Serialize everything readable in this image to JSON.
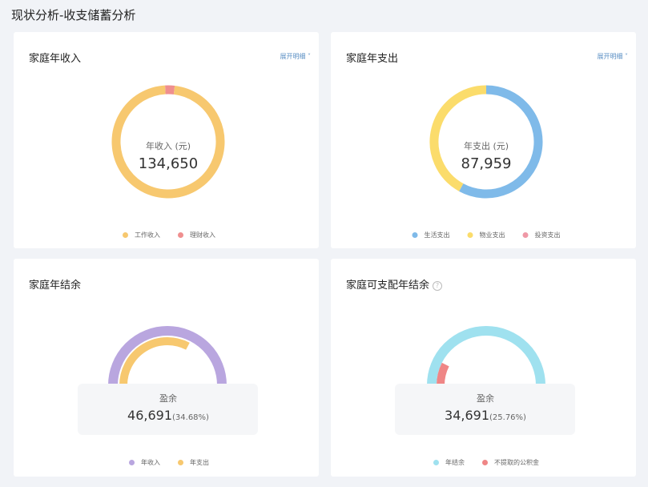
{
  "page_title": "现状分析-收支储蓄分析",
  "colors": {
    "yellow": "#f7c86f",
    "salmon": "#ef8f8f",
    "blue": "#7fbae9",
    "lightyellow": "#fbdc6b",
    "pink": "#ef98a6",
    "purple": "#b9a6df",
    "cyan": "#9fe1ef",
    "red": "#ef8686"
  },
  "income": {
    "title": "家庭年收入",
    "expand": "展开明细 ˅",
    "center_label": "年收入 (元)",
    "center_value": "134,650",
    "legend": [
      "工作收入",
      "理财收入"
    ]
  },
  "expense": {
    "title": "家庭年支出",
    "expand": "展开明细 ˅",
    "center_label": "年支出 (元)",
    "center_value": "87,959",
    "legend": [
      "生活支出",
      "物业支出",
      "投资支出"
    ]
  },
  "surplus": {
    "title": "家庭年结余",
    "label": "盈余",
    "value": "46,691",
    "pct": "(34.68%)",
    "legend": [
      "年收入",
      "年支出"
    ]
  },
  "disposable": {
    "title": "家庭可支配年结余",
    "help": "?",
    "label": "盈余",
    "value": "34,691",
    "pct": "(25.76%)",
    "legend": [
      "年结余",
      "不提取的公积金"
    ]
  },
  "chart_data": [
    {
      "type": "pie",
      "title": "家庭年收入",
      "categories": [
        "工作收入",
        "理财收入"
      ],
      "values": [
        130950,
        3700
      ],
      "total": 134650
    },
    {
      "type": "pie",
      "title": "家庭年支出",
      "categories": [
        "生活支出",
        "物业支出",
        "投资支出"
      ],
      "values": [
        51000,
        36959,
        0
      ],
      "total": 87959
    },
    {
      "type": "pie",
      "title": "家庭年结余",
      "series": [
        {
          "name": "年收入",
          "values": [
            134650
          ]
        },
        {
          "name": "年支出",
          "values": [
            87959
          ]
        }
      ],
      "surplus": 46691,
      "surplus_pct": 34.68
    },
    {
      "type": "pie",
      "title": "家庭可支配年结余",
      "series": [
        {
          "name": "年结余",
          "values": [
            134650
          ]
        },
        {
          "name": "不提取的公积金",
          "values": [
            34691
          ]
        }
      ],
      "surplus": 34691,
      "surplus_pct": 25.76
    }
  ]
}
